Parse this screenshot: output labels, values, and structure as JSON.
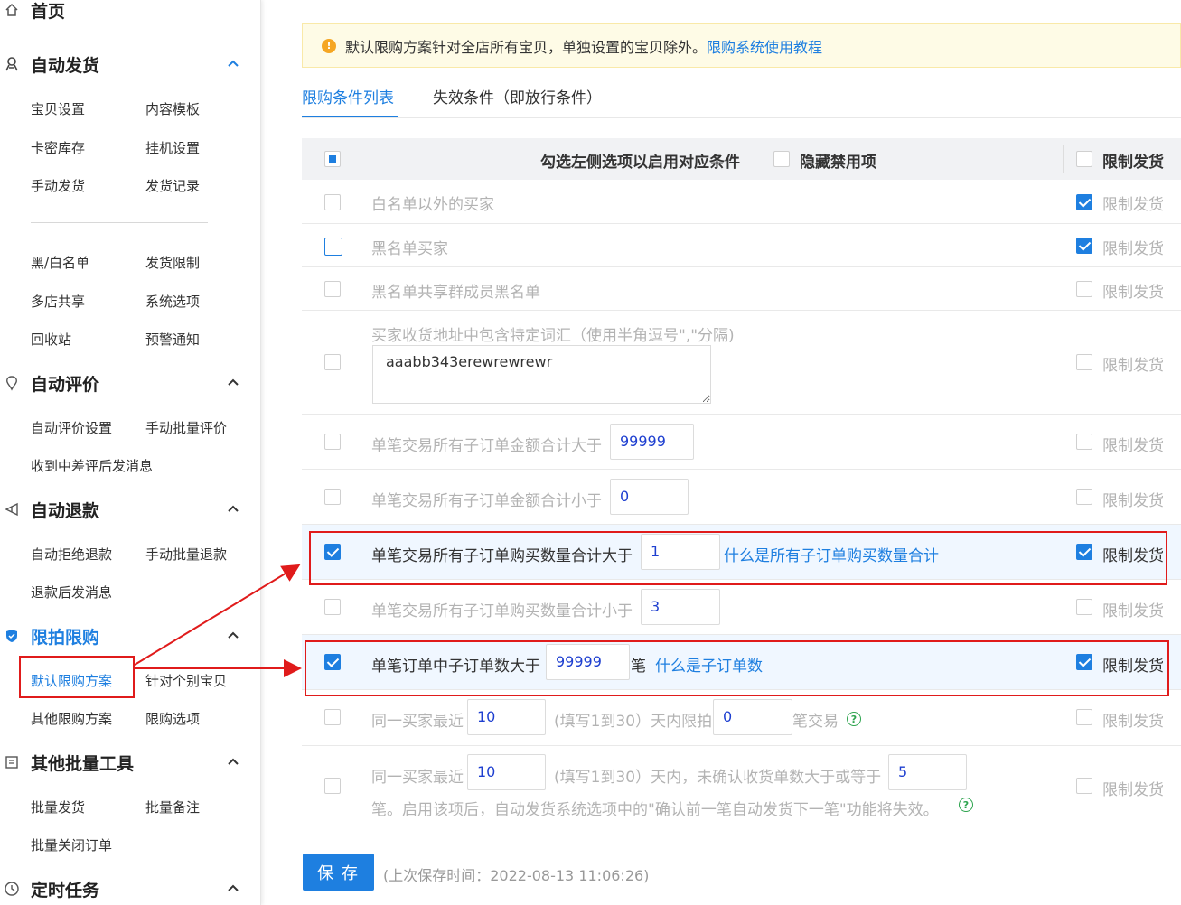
{
  "sidebar": {
    "home": "首页",
    "sections": [
      {
        "title": "自动发货",
        "icon": "robot-icon",
        "items": [
          "宝贝设置",
          "内容模板",
          "卡密库存",
          "挂机设置",
          "手动发货",
          "发货记录",
          "黑/白名单",
          "发货限制",
          "多店共享",
          "系统选项",
          "回收站",
          "预警通知"
        ]
      },
      {
        "title": "自动评价",
        "icon": "thumb-icon",
        "items": [
          "自动评价设置",
          "手动批量评价",
          "收到中差评后发消息"
        ]
      },
      {
        "title": "自动退款",
        "icon": "refund-icon",
        "items": [
          "自动拒绝退款",
          "手动批量退款",
          "退款后发消息"
        ]
      },
      {
        "title": "限拍限购",
        "icon": "shield-icon",
        "items": [
          "默认限购方案",
          "针对个别宝贝",
          "其他限购方案",
          "限购选项"
        ]
      },
      {
        "title": "其他批量工具",
        "icon": "list-icon",
        "items": [
          "批量发货",
          "批量备注",
          "批量关闭订单"
        ]
      },
      {
        "title": "定时任务",
        "icon": "clock-icon",
        "items": []
      }
    ]
  },
  "notice": {
    "text": "默认限购方案针对全店所有宝贝，单独设置的宝贝除外。",
    "link": "限购系统使用教程"
  },
  "tabs": [
    "限购条件列表",
    "失效条件（即放行条件）"
  ],
  "table": {
    "header_label": "勾选左侧选项以启用对应条件",
    "hide_disabled": "隐藏禁用项",
    "limit_header": "限制发货",
    "limit_label": "限制发货"
  },
  "rows": {
    "r1": "白名单以外的买家",
    "r2": "黑名单买家",
    "r3": "黑名单共享群成员黑名单",
    "r4": "买家收货地址中包含特定词汇（使用半角逗号\",\"分隔)",
    "r4_value": "aaabb343erewrewrewr",
    "r5": "单笔交易所有子订单金额合计大于",
    "r5_value": "99999",
    "r6": "单笔交易所有子订单金额合计小于",
    "r6_value": "0",
    "r7": "单笔交易所有子订单购买数量合计大于",
    "r7_value": "1",
    "r7_link": "什么是所有子订单购买数量合计",
    "r8": "单笔交易所有子订单购买数量合计小于",
    "r8_value": "3",
    "r9": "单笔订单中子订单数大于",
    "r9_value": "99999",
    "r9_unit": "笔",
    "r9_link": "什么是子订单数",
    "r10_a": "同一买家最近",
    "r10_v1": "10",
    "r10_b": "(填写1到30）天内限拍",
    "r10_v2": "0",
    "r10_c": "笔交易",
    "r11_a": "同一买家最近",
    "r11_v1": "10",
    "r11_b": "(填写1到30）天内，未确认收货单数大于或等于",
    "r11_v2": "5",
    "r11_c": "笔。启用该项后，自动发货系统选项中的\"确认前一笔自动发货下一笔\"功能将失效。"
  },
  "save": {
    "button": "保 存",
    "time": "(上次保存时间：2022-08-13 11:06:26)"
  },
  "colors": {
    "accent": "#1e7fe0",
    "highlight": "#e01b1b",
    "notice_bg": "#fefbe6"
  }
}
